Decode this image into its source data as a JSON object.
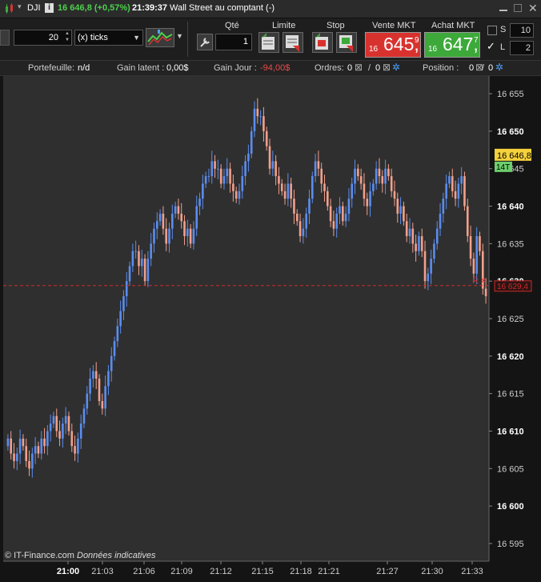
{
  "titlebar": {
    "symbol": "DJI",
    "info_icon": "info-icon",
    "price_change": "16 646,8 (+0,57%)",
    "time": "21:39:37",
    "instrument_name": "Wall Street au comptant (-)"
  },
  "toolbar": {
    "interval_value": "20",
    "interval_unit": "(x) ticks",
    "qty_label": "Qté",
    "qty_value": "1",
    "limit_label": "Limite",
    "stop_label": "Stop",
    "sell_label": "Vente MKT",
    "sell_price_small": "16",
    "sell_price_big": "645,",
    "sell_price_sup": "9",
    "buy_label": "Achat MKT",
    "buy_price_small": "16",
    "buy_price_big": "647,",
    "buy_price_sup": "7",
    "s_label": "S",
    "s_value": "10",
    "l_label": "L",
    "l_value": "2"
  },
  "infobar": {
    "portfolio_label": "Portefeuille:",
    "portfolio_value": "n/d",
    "latent_label": "Gain latent :",
    "latent_value": "0,00$",
    "day_label": "Gain Jour :",
    "day_value": "-94,00$",
    "orders_label": "Ordres:",
    "orders_a": "0",
    "orders_sep": "/",
    "orders_b": "0",
    "position_label": "Position :",
    "position_a": "0",
    "position_sep": "/",
    "position_b": "0"
  },
  "colors": {
    "up": "#5b8def",
    "down": "#f2a08c",
    "position_line": "#d02828",
    "last_price_badge": "#f5d13d",
    "tick_badge": "#6ccf6c",
    "sell": "#d8322f",
    "buy": "#3da93a"
  },
  "chart_data": {
    "type": "candlestick",
    "y_ticks": [
      "16 655",
      "16 650",
      "16 645",
      "16 640",
      "16 635",
      "16 630",
      "16 625",
      "16 620",
      "16 615",
      "16 610",
      "16 605",
      "16 600",
      "16 595"
    ],
    "x_ticks": [
      "21:00",
      "21:03",
      "21:06",
      "21:09",
      "21:12",
      "21:15",
      "21:18",
      "21:21",
      "21:27",
      "21:30",
      "21:33"
    ],
    "ylim": [
      16593.5,
      16656.5
    ],
    "last_price_label": "16 646,8",
    "last_price": 16646.8,
    "tick_label": "14T",
    "position_label": "R",
    "position_price_label": "16 629,4",
    "position_price": 16629.4,
    "copyright": "© IT-Finance.com",
    "disclaimer": "Données indicatives",
    "closes": [
      16609,
      16607,
      16606,
      16607,
      16609,
      16608,
      16606,
      16605,
      16607,
      16608,
      16607,
      16609,
      16608,
      16610,
      16611,
      16612,
      16610,
      16609,
      16611,
      16612,
      16610,
      16608,
      16607,
      16609,
      16611,
      16613,
      16615,
      16617,
      16618,
      16617,
      16614,
      16613,
      16616,
      16618,
      16620,
      16622,
      16624,
      16626,
      16628,
      16630,
      16632,
      16634,
      16634,
      16632,
      16633,
      16630,
      16633,
      16635,
      16637,
      16638,
      16639,
      16637,
      16635,
      16637,
      16639,
      16640,
      16639,
      16638,
      16636,
      16637,
      16635,
      16637,
      16640,
      16641,
      16643,
      16644,
      16644,
      16646,
      16645,
      16645,
      16643,
      16644,
      16645,
      16643,
      16642,
      16641,
      16642,
      16644,
      16646,
      16647,
      16650,
      16653,
      16652,
      16652,
      16650,
      16648,
      16645,
      16646,
      16644,
      16643,
      16642,
      16641,
      16643,
      16641,
      16639,
      16638,
      16636,
      16637,
      16639,
      16641,
      16644,
      16646,
      16645,
      16643,
      16642,
      16640,
      16638,
      16637,
      16639,
      16640,
      16638,
      16639,
      16641,
      16643,
      16645,
      16644,
      16643,
      16641,
      16640,
      16642,
      16643,
      16645,
      16644,
      16643,
      16645,
      16644,
      16642,
      16641,
      16639,
      16640,
      16638,
      16636,
      16637,
      16635,
      16634,
      16636,
      16634,
      16630,
      16631,
      16633,
      16635,
      16637,
      16639,
      16641,
      16643,
      16644,
      16642,
      16641,
      16643,
      16644,
      16640,
      16636,
      16633,
      16631,
      16636,
      16634,
      16629,
      16628
    ]
  }
}
